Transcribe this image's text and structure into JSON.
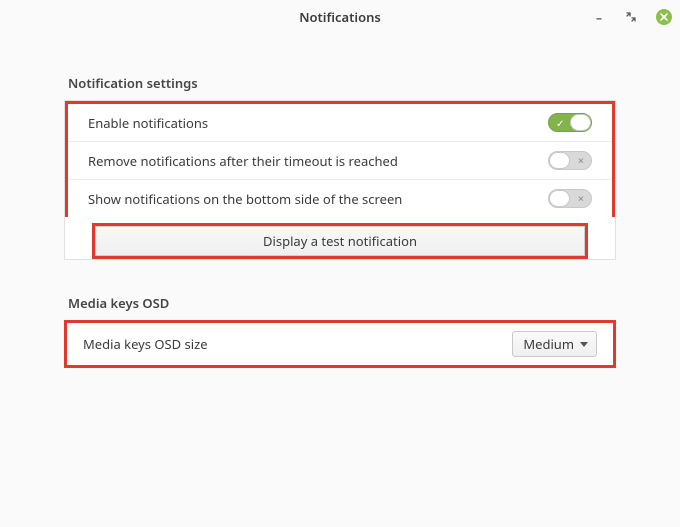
{
  "window": {
    "title": "Notifications"
  },
  "sections": {
    "notif": {
      "title": "Notification settings",
      "rows": {
        "enable": {
          "label": "Enable notifications",
          "on": true
        },
        "remove_timeout": {
          "label": "Remove notifications after their timeout is reached",
          "on": false
        },
        "bottom_side": {
          "label": "Show notifications on the bottom side of the screen",
          "on": false
        }
      },
      "test_button": "Display a test notification"
    },
    "osd": {
      "title": "Media keys OSD",
      "row": {
        "label": "Media keys OSD size",
        "value": "Medium"
      }
    }
  },
  "glyphs": {
    "check": "✓",
    "cross": "×",
    "minimize": "–"
  }
}
